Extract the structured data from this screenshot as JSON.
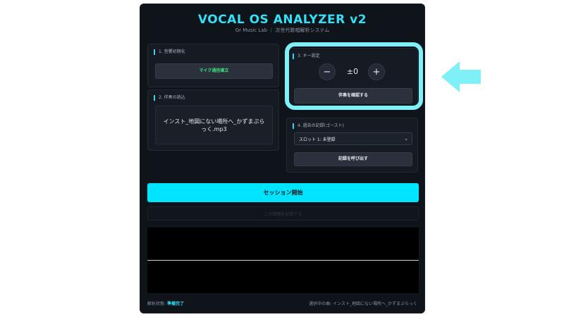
{
  "app": {
    "title": "VOCAL OS ANALYZER v2",
    "subtitle": "Gr Music Lab ｜ 次世代歌唱解析システム"
  },
  "audio_init": {
    "label": "1. 音響初期化",
    "mic_button": "マイク通信確立"
  },
  "song_load": {
    "label": "2. 伴奏の読込",
    "file_name": "インスト_地図にない場所へ_かずまぷらっく.mp3"
  },
  "key_setting": {
    "label": "3. キー設定",
    "minus": "−",
    "value": "±0",
    "plus": "+",
    "confirm_button": "伴奏を確認する"
  },
  "history": {
    "label": "4. 過去の記録(ゴースト)",
    "slot_selected": "スロット 1: 未登録",
    "recall_button": "記録を呼び出す"
  },
  "session": {
    "start_button": "セッション開始",
    "record_button": "この情報を記録する"
  },
  "status": {
    "label": "解析状態:",
    "value": "準備完了",
    "current_song": "選択中の曲: インスト_地図にない場所へ_かずまぷらっく"
  },
  "colors": {
    "accent": "#00e5ff",
    "highlight": "#7ff0f6",
    "mic_ready": "#3ee07a",
    "background": "#0f131a"
  }
}
